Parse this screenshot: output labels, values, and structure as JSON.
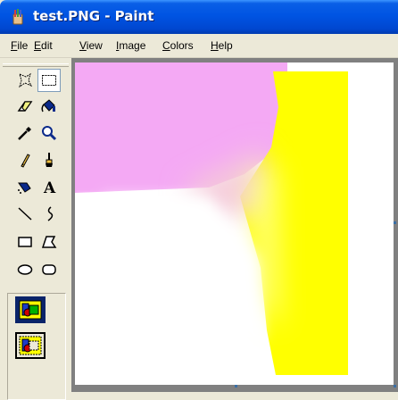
{
  "window": {
    "title": "test.PNG - Paint",
    "icon": "paint-brush-cup-icon"
  },
  "menu": [
    {
      "label": "File",
      "accel": "F",
      "rest": "ile"
    },
    {
      "label": "Edit",
      "accel": "E",
      "rest": "dit"
    },
    {
      "label": "View",
      "accel": "V",
      "rest": "iew"
    },
    {
      "label": "Image",
      "accel": "I",
      "rest": "mage"
    },
    {
      "label": "Colors",
      "accel": "C",
      "rest": "olors"
    },
    {
      "label": "Help",
      "accel": "H",
      "rest": "elp"
    }
  ],
  "tools": [
    {
      "name": "free-form-select-icon",
      "selected": false
    },
    {
      "name": "rectangle-select-icon",
      "selected": true
    },
    {
      "name": "eraser-icon",
      "selected": false
    },
    {
      "name": "fill-bucket-icon",
      "selected": false
    },
    {
      "name": "color-picker-icon",
      "selected": false
    },
    {
      "name": "magnifier-icon",
      "selected": false
    },
    {
      "name": "pencil-icon",
      "selected": false
    },
    {
      "name": "brush-icon",
      "selected": false
    },
    {
      "name": "airbrush-icon",
      "selected": false
    },
    {
      "name": "text-icon",
      "selected": false
    },
    {
      "name": "line-icon",
      "selected": false
    },
    {
      "name": "curve-icon",
      "selected": false
    },
    {
      "name": "rectangle-icon",
      "selected": false
    },
    {
      "name": "polygon-icon",
      "selected": false
    },
    {
      "name": "ellipse-icon",
      "selected": false
    },
    {
      "name": "rounded-rectangle-icon",
      "selected": false
    }
  ],
  "text_tool_glyph": "A",
  "selection_options": [
    {
      "name": "opaque-selection-icon",
      "selected": true
    },
    {
      "name": "transparent-selection-icon",
      "selected": false
    }
  ],
  "colors": {
    "title_bar": "#0054e3",
    "face": "#ece9d8",
    "workspace": "#808080",
    "canvas_bg": "#ffffff",
    "pink": "#f4a9f4",
    "yellow": "#ffff00",
    "highlight": "#0a246a"
  }
}
